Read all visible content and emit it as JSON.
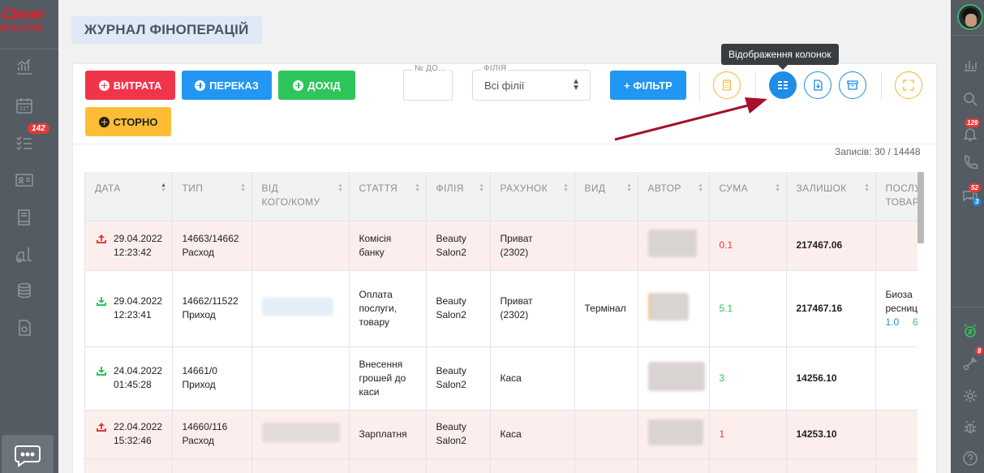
{
  "logo": {
    "line1": "Clever",
    "line2": "BOX.CRM"
  },
  "left_sidebar": {
    "badge_count": "142"
  },
  "page": {
    "title": "ЖУРНАЛ ФІНОПЕРАЦІЙ"
  },
  "toolbar": {
    "expense_label": "ВИТРАТА",
    "transfer_label": "ПЕРЕКАЗ",
    "income_label": "ДОХІД",
    "storno_label": "СТОРНО",
    "doc_number_label": "№ ДО...",
    "branch_label": "ФІЛІЯ",
    "branch_value": "Всі філії",
    "filter_label": "+ ФІЛЬТР"
  },
  "tooltip": {
    "columns_display": "Відображення колонок"
  },
  "records": {
    "text": "Записів: 30 / 14448"
  },
  "table": {
    "headers": {
      "date": "ДАТА",
      "type": "ТИП",
      "from_to": "ВІД КОМУ/КОМУ",
      "from_to_line1": "ВІД",
      "from_to_line2": "КОГО/КОМУ",
      "article": "СТАТТЯ",
      "branch": "ФІЛІЯ",
      "account": "РАХУНОК",
      "kind": "ВИД",
      "author": "АВТОР",
      "amount": "СУМА",
      "balance": "ЗАЛИШОК",
      "services_line1": "ПОСЛУ",
      "services_line2": "ТОВАР"
    },
    "rows": [
      {
        "direction": "out",
        "date": "29.04.2022",
        "time": "12:23:42",
        "type_num": "14663/14662",
        "type_name": "Расход",
        "article_l1": "Комісія",
        "article_l2": "банку",
        "article_l3": "",
        "branch_l1": "Beauty",
        "branch_l2": "Salon2",
        "account_l1": "Приват",
        "account_l2": "(2302)",
        "kind": "",
        "amount": "0.1",
        "balance": "217467.06",
        "services_l1": "",
        "services_l2a": "",
        "services_l2b": ""
      },
      {
        "direction": "in",
        "date": "29.04.2022",
        "time": "12:23:41",
        "type_num": "14662/11522",
        "type_name": "Приход",
        "article_l1": "Оплата",
        "article_l2": "послуги,",
        "article_l3": "товару",
        "branch_l1": "Beauty",
        "branch_l2": "Salon2",
        "account_l1": "Приват",
        "account_l2": "(2302)",
        "kind": "Термінал",
        "amount": "5.1",
        "balance": "217467.16",
        "services_l1": "Биоза",
        "services_l2": "ресниц",
        "services_l3a": "1.0",
        "services_l3b": "6"
      },
      {
        "direction": "in",
        "date": "24.04.2022",
        "time": "01:45:28",
        "type_num": "14661/0",
        "type_name": "Приход",
        "article_l1": "Внесення",
        "article_l2": "грошей до",
        "article_l3": "каси",
        "branch_l1": "Beauty",
        "branch_l2": "Salon2",
        "account_l1": "Каса",
        "account_l2": "",
        "kind": "",
        "amount": "3",
        "balance": "14256.10"
      },
      {
        "direction": "out",
        "date": "22.04.2022",
        "time": "15:32:46",
        "type_num": "14660/116",
        "type_name": "Расход",
        "article_l1": "Зарплатня",
        "article_l2": "",
        "article_l3": "",
        "branch_l1": "Beauty",
        "branch_l2": "Salon2",
        "account_l1": "Каса",
        "account_l2": "",
        "kind": "",
        "amount": "1",
        "balance": "14253.10"
      }
    ]
  },
  "right_sidebar": {
    "notifications_badge": "129",
    "calls_badge": "52",
    "chat_badge": "3",
    "tasks_badge": "8"
  },
  "colors": {
    "expense": "#f0354a",
    "primary": "#2196f3",
    "income": "#2ec55a",
    "storno": "#fdbd35",
    "sidebar": "#545b62",
    "arrow": "#a5102a"
  }
}
